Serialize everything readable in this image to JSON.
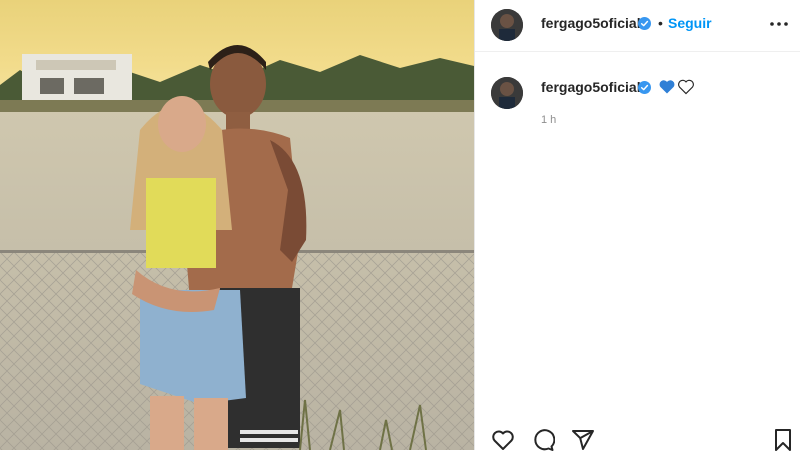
{
  "post": {
    "username": "fergago5oficial",
    "follow_label": "Seguir",
    "separator": "•"
  },
  "comment": {
    "username": "fergago5oficial",
    "emojis": [
      "blue-heart",
      "white-heart"
    ],
    "timestamp": "1 h"
  },
  "icons": {
    "more": "more-options-icon",
    "like": "heart-outline-icon",
    "comment": "comment-bubble-icon",
    "share": "paper-plane-icon",
    "save": "bookmark-icon",
    "verified": "verified-badge-icon"
  },
  "colors": {
    "accent": "#0095f6",
    "text": "#262626",
    "muted": "#8e8e8e",
    "verified": "#3897f0",
    "blue_heart": "#2f7fd6"
  }
}
